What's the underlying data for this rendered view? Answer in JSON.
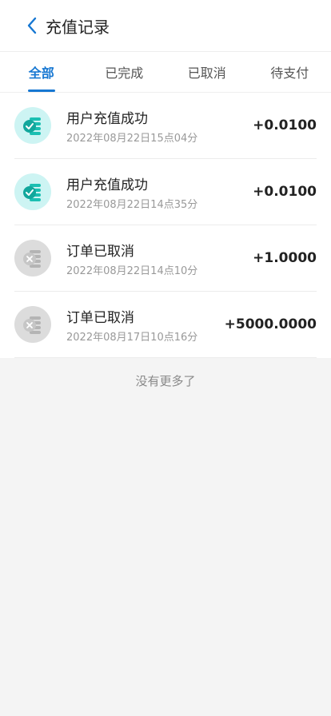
{
  "header": {
    "title": "充值记录"
  },
  "tabs": [
    {
      "label": "全部",
      "active": true
    },
    {
      "label": "已完成",
      "active": false
    },
    {
      "label": "已取消",
      "active": false
    },
    {
      "label": "待支付",
      "active": false
    }
  ],
  "records": [
    {
      "title": "用户充值成功",
      "time": "2022年08月22日15点04分",
      "amount": "+0.0100",
      "status": "success",
      "icon": "coin-check-icon"
    },
    {
      "title": "用户充值成功",
      "time": "2022年08月22日14点35分",
      "amount": "+0.0100",
      "status": "success",
      "icon": "coin-check-icon"
    },
    {
      "title": "订单已取消",
      "time": "2022年08月22日14点10分",
      "amount": "+1.0000",
      "status": "cancelled",
      "icon": "coin-cancel-icon"
    },
    {
      "title": "订单已取消",
      "time": "2022年08月17日10点16分",
      "amount": "+5000.0000",
      "status": "cancelled",
      "icon": "coin-cancel-icon"
    }
  ],
  "footer": {
    "no_more": "没有更多了"
  },
  "colors": {
    "accent": "#1677d2",
    "success": "#1bbfb2",
    "cancelled": "#b4b4b4"
  }
}
